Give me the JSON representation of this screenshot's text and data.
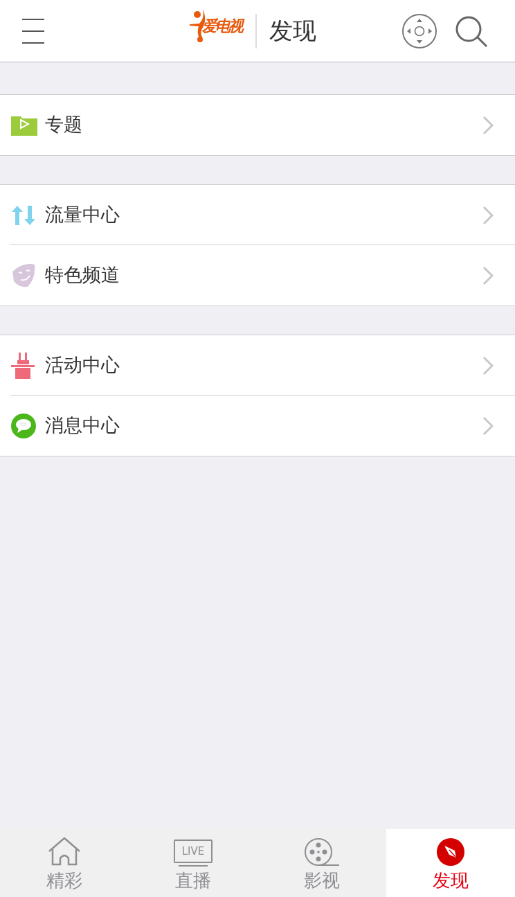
{
  "header": {
    "logo": "爱电视",
    "title": "发现"
  },
  "groups": [
    {
      "items": [
        {
          "kind": "topic",
          "label": "专题"
        }
      ]
    },
    {
      "items": [
        {
          "kind": "traffic",
          "label": "流量中心"
        },
        {
          "kind": "channel",
          "label": "特色频道"
        }
      ]
    },
    {
      "items": [
        {
          "kind": "event",
          "label": "活动中心"
        },
        {
          "kind": "message",
          "label": "消息中心"
        }
      ]
    }
  ],
  "tabs": [
    {
      "kind": "home",
      "label": "精彩",
      "selected": false
    },
    {
      "kind": "live",
      "label": "直播",
      "selected": false,
      "icon_text": "LIVE"
    },
    {
      "kind": "film",
      "label": "影视",
      "selected": false
    },
    {
      "kind": "discover",
      "label": "发现",
      "selected": true
    }
  ]
}
